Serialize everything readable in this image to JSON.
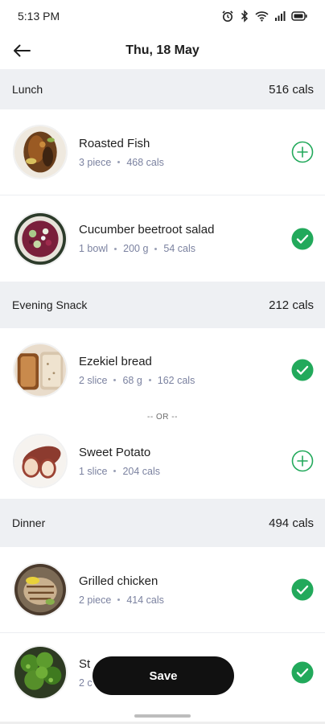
{
  "status_bar": {
    "time": "5:13 PM"
  },
  "header": {
    "title": "Thu, 18 May"
  },
  "sections": [
    {
      "name": "Lunch",
      "cals": "516 cals",
      "items": [
        {
          "name": "Roasted Fish",
          "meta": [
            "3 piece",
            "468 cals"
          ],
          "status": "add"
        },
        {
          "name": "Cucumber beetroot salad",
          "meta": [
            "1 bowl",
            "200 g",
            "54 cals"
          ],
          "status": "done"
        }
      ]
    },
    {
      "name": "Evening Snack",
      "cals": "212 cals",
      "items": [
        {
          "name": "Ezekiel bread",
          "meta": [
            "2 slice",
            "68 g",
            "162 cals"
          ],
          "status": "done"
        },
        {
          "name": "Sweet Potato",
          "meta": [
            "1 slice",
            "204 cals"
          ],
          "status": "add"
        }
      ],
      "divider": "-- OR --"
    },
    {
      "name": "Dinner",
      "cals": "494 cals",
      "items": [
        {
          "name": "Grilled chicken",
          "meta": [
            "2 piece",
            "414 cals"
          ],
          "status": "done"
        },
        {
          "name": "St",
          "meta": [
            "2 c"
          ],
          "status": "done"
        }
      ]
    }
  ],
  "save_button": {
    "label": "Save"
  },
  "colors": {
    "accent_green": "#22a95b",
    "section_bg": "#eef0f3",
    "meta_text": "#7b82a0",
    "button_bg": "#111111"
  },
  "icons": [
    "alarm-icon",
    "bluetooth-icon",
    "wifi-icon",
    "signal-icon",
    "battery-icon",
    "back-arrow-icon",
    "plus-circle-icon",
    "check-circle-icon"
  ]
}
